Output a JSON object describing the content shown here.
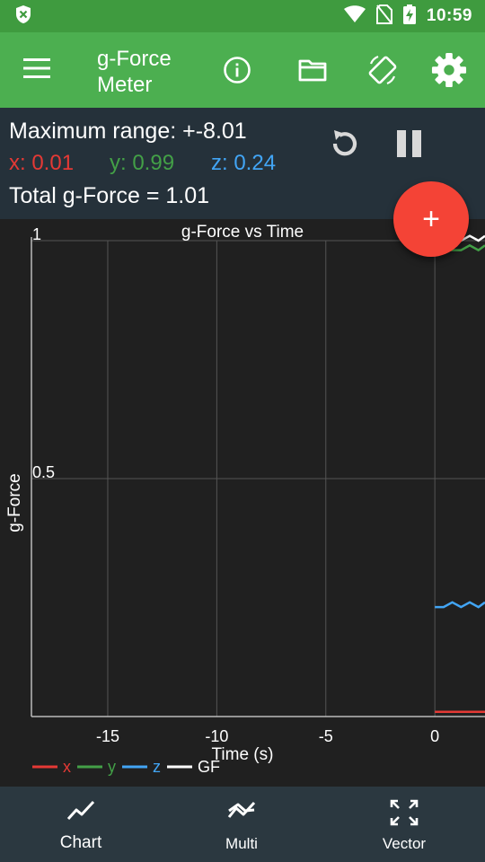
{
  "status_bar": {
    "time": "10:59"
  },
  "app_bar": {
    "title_line1": "g-Force",
    "title_line2": "Meter"
  },
  "readout": {
    "max_range": "Maximum range: +-8.01",
    "x": "x: 0.01",
    "y": "y: 0.99",
    "z": "z: 0.24",
    "total": "Total g-Force = 1.01"
  },
  "fab": {
    "label": "+"
  },
  "colors": {
    "status_bar": "#3f9b3f",
    "app_bar": "#4caf50",
    "readout_bg": "#25313a",
    "chart_bg": "#202020",
    "x": "#e53935",
    "y": "#43a047",
    "z": "#42a5f5",
    "gf": "#ffffff",
    "fab": "#f44336",
    "bottom_nav": "#2b3840"
  },
  "chart_data": {
    "type": "line",
    "title": "g-Force vs Time",
    "xlabel": "Time (s)",
    "ylabel": "g-Force",
    "xlim": [
      -18.5,
      2.3
    ],
    "ylim": [
      0,
      1
    ],
    "xticks": [
      -15,
      -10,
      -5,
      0
    ],
    "xtick_labels": [
      "-15",
      "-10",
      "-5",
      "0"
    ],
    "yticks": [
      1,
      0.5
    ],
    "ytick_labels": [
      "1",
      "0.5"
    ],
    "grid": true,
    "legend_placement": "bottom-left",
    "series": [
      {
        "name": "x",
        "x": [
          0,
          0.4,
          0.8,
          1.2,
          1.6,
          2.0,
          2.3
        ],
        "values": [
          0.01,
          0.01,
          0.01,
          0.01,
          0.01,
          0.01,
          0.01
        ]
      },
      {
        "name": "y",
        "x": [
          0,
          0.4,
          0.8,
          1.2,
          1.6,
          2.0,
          2.3
        ],
        "values": [
          0.98,
          0.98,
          0.98,
          0.98,
          0.99,
          0.98,
          0.99
        ]
      },
      {
        "name": "z",
        "x": [
          0,
          0.4,
          0.8,
          1.2,
          1.6,
          2.0,
          2.3
        ],
        "values": [
          0.23,
          0.23,
          0.24,
          0.23,
          0.24,
          0.23,
          0.24
        ]
      },
      {
        "name": "GF",
        "x": [
          0,
          0.4,
          0.8,
          1.2,
          1.6,
          2.0,
          2.3
        ],
        "values": [
          1.0,
          1.0,
          1.0,
          1.0,
          1.01,
          1.0,
          1.01
        ]
      }
    ]
  },
  "bottom_nav": {
    "items": [
      {
        "label": "Chart",
        "icon": "chart-icon"
      },
      {
        "label": "Multi",
        "icon": "multi-icon"
      },
      {
        "label": "Vector",
        "icon": "vector-icon"
      }
    ]
  }
}
